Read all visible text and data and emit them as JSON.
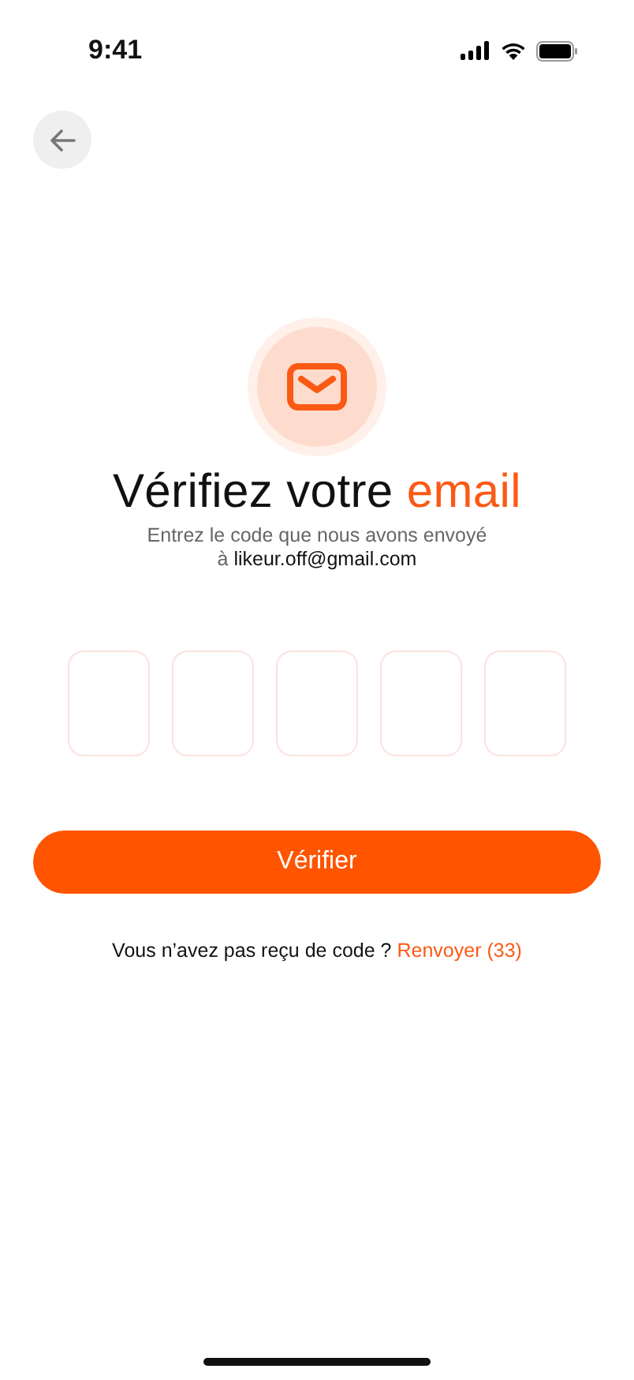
{
  "status_bar": {
    "time": "9:41"
  },
  "title": {
    "text": "Vérifiez votre",
    "highlight": "email"
  },
  "subtitle": {
    "text": "Entrez le code que nous avons envoyé",
    "prefix": "à",
    "email": "likeur.off@gmail.com"
  },
  "code_fields": [
    {
      "kind": "digit"
    },
    {
      "kind": "digit"
    },
    {
      "kind": "digit"
    },
    {
      "kind": "digit"
    },
    {
      "kind": "digit"
    }
  ],
  "submit_button": {
    "label": "Vérifier"
  },
  "resend": {
    "text": "Vous n’avez pas reçu de code ?",
    "link": "Renvoyer (33)"
  }
}
